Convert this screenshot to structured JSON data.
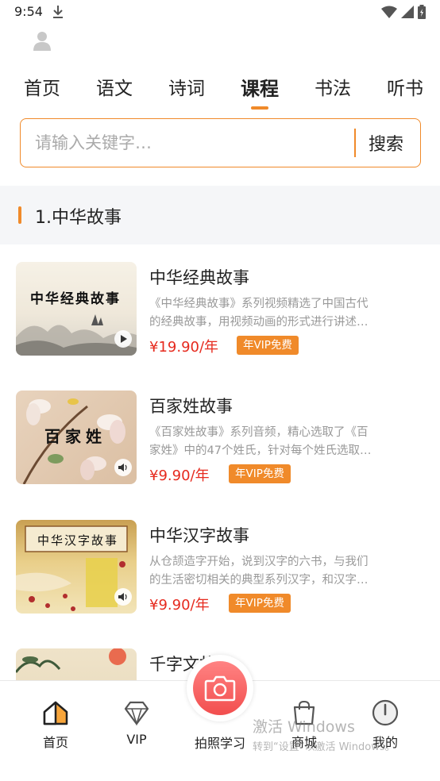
{
  "status_bar": {
    "time": "9:54"
  },
  "tabs": [
    {
      "label": "首页"
    },
    {
      "label": "语文"
    },
    {
      "label": "诗词"
    },
    {
      "label": "课程",
      "active": true
    },
    {
      "label": "书法"
    },
    {
      "label": "听书"
    }
  ],
  "search": {
    "placeholder": "请输入关键字…",
    "button_label": "搜索"
  },
  "section": {
    "title": "1.中华故事"
  },
  "courses": [
    {
      "thumb_title": "中华经典故事",
      "media": "play-icon",
      "title": "中华经典故事",
      "desc_line1": "《中华经典故事》系列视频精选了中国古代",
      "desc_line2": "的经典故事，用视频动画的形式进行讲述…",
      "price": "¥19.90/年",
      "badge": "年VIP免费"
    },
    {
      "thumb_title": "百家姓",
      "media": "audio-icon",
      "title": "百家姓故事",
      "desc_line1": "《百家姓故事》系列音频，精心选取了《百",
      "desc_line2": "家姓》中的47个姓氏，针对每个姓氏选取…",
      "price": "¥9.90/年",
      "badge": "年VIP免费"
    },
    {
      "thumb_title": "中华汉字故事",
      "media": "audio-icon",
      "title": "中华汉字故事",
      "desc_line1": "从仓颉造字开始，说到汉字的六书，与我们",
      "desc_line2": "的生活密切相关的典型系列汉字，和汉字…",
      "price": "¥9.90/年",
      "badge": "年VIP免费"
    },
    {
      "title": "千字文故事"
    }
  ],
  "bottom_nav": [
    {
      "label": "首页",
      "icon": "home-icon"
    },
    {
      "label": "VIP",
      "icon": "diamond-icon"
    },
    {
      "label": "拍照学习",
      "icon": "camera-icon"
    },
    {
      "label": "商城",
      "icon": "shopping-bag-icon"
    },
    {
      "label": "我的",
      "icon": "profile-icon"
    }
  ],
  "watermark": {
    "line1": "激活 Windows",
    "line2": "转到“设置”以激活 Windows。"
  },
  "colors": {
    "accent": "#f08a2a",
    "price": "#e62a1e",
    "camera": "#f24e4e"
  }
}
